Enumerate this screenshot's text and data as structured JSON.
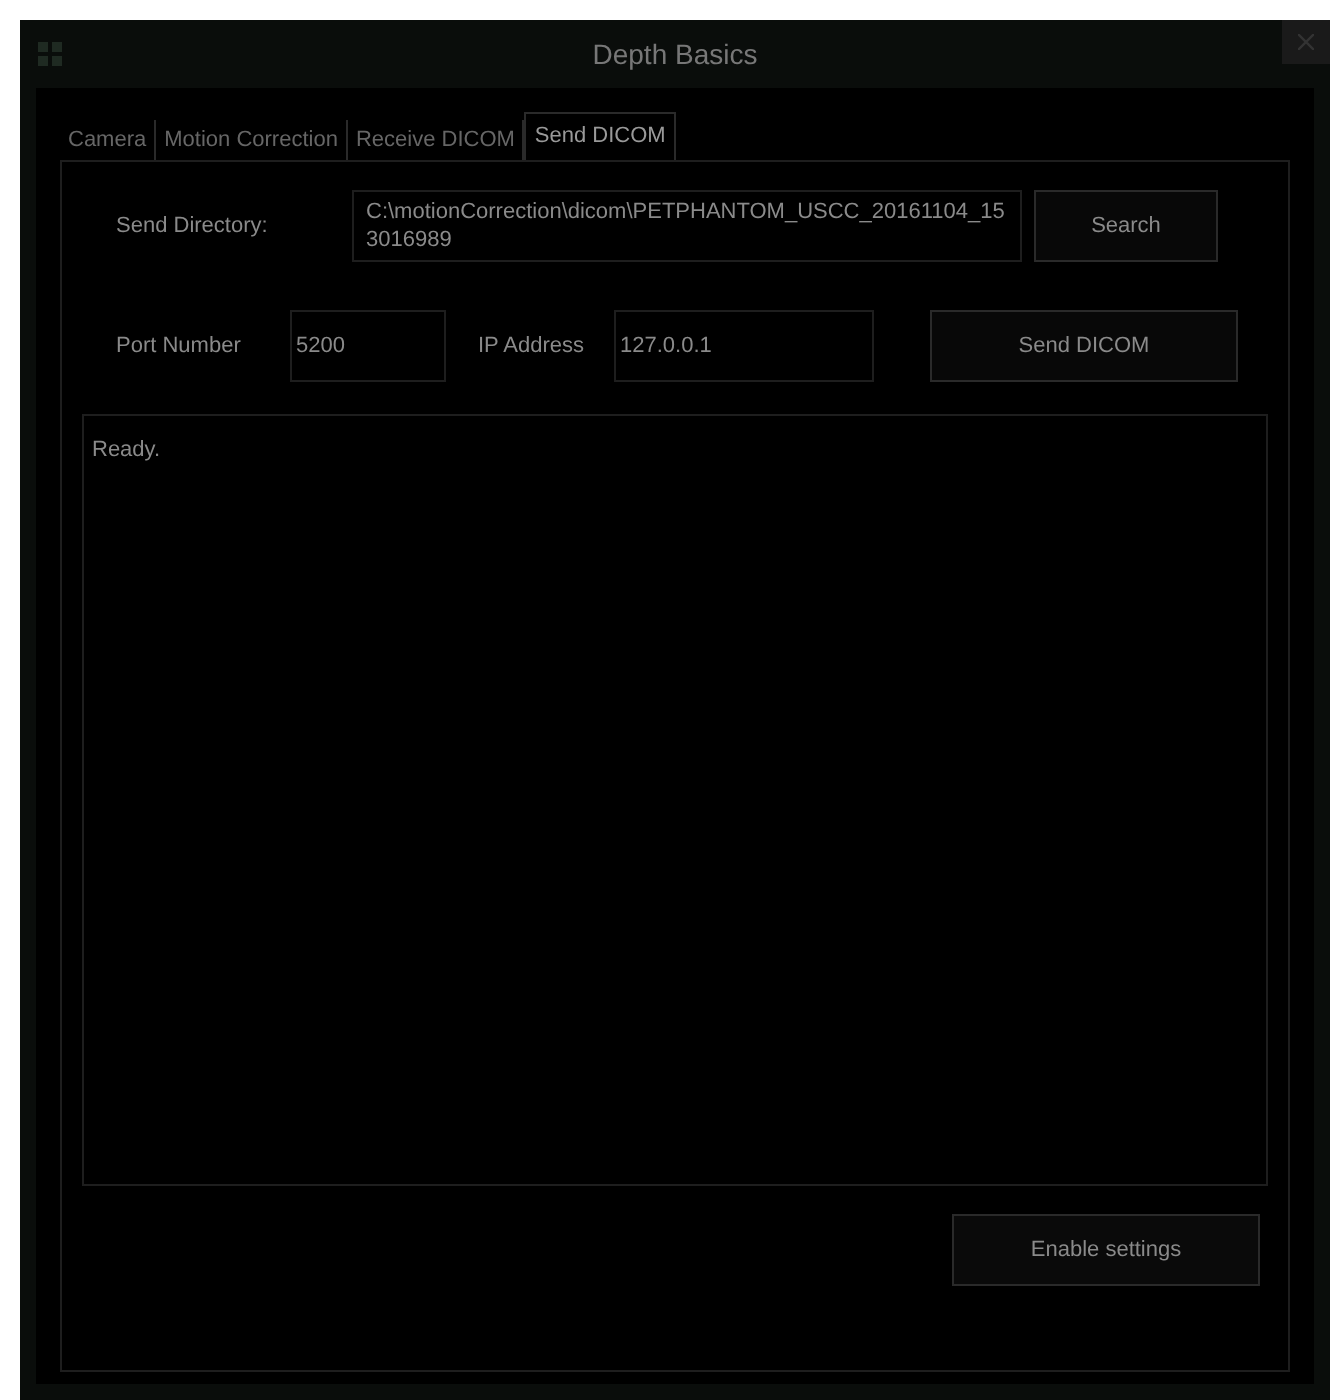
{
  "window": {
    "title": "Depth Basics"
  },
  "tabs": [
    {
      "label": "Camera",
      "selected": false
    },
    {
      "label": "Motion Correction",
      "selected": false
    },
    {
      "label": "Receive DICOM",
      "selected": false
    },
    {
      "label": "Send DICOM",
      "selected": true
    }
  ],
  "send_directory": {
    "label": "Send Directory:",
    "value": "C:\\motionCorrection\\dicom\\PETPHANTOM_USCC_20161104_153016989"
  },
  "search_button": "Search",
  "port": {
    "label": "Port Number",
    "value": "5200"
  },
  "ip": {
    "label": "IP Address",
    "value": "127.0.0.1"
  },
  "send_button": "Send DICOM",
  "log": "Ready.",
  "enable_button": "Enable settings"
}
